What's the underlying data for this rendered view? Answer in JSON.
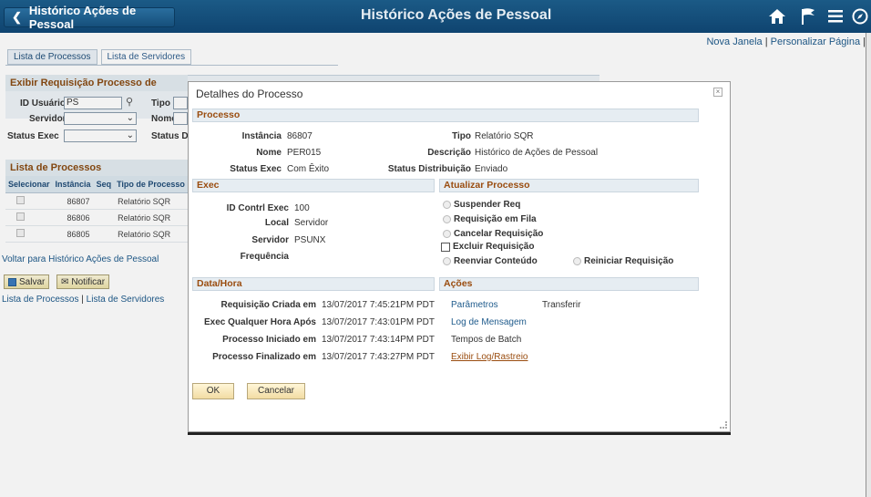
{
  "header": {
    "back_label": "Histórico Ações de Pessoal",
    "title": "Histórico Ações de Pessoal",
    "icons": [
      "home-icon",
      "flag-icon",
      "menu-icon",
      "navigator-icon"
    ]
  },
  "top_links": {
    "new_window": "Nova Janela",
    "separator": "|",
    "personalize": "Personalizar Página",
    "separator2": "|"
  },
  "bg": {
    "tabs": [
      "Lista de Processos",
      "Lista de Servidores"
    ],
    "search_header": "Exibir Requisição Processo de",
    "user_id_label": "ID Usuário",
    "user_id_value": "PS",
    "tipo_label": "Tipo",
    "servidor_label": "Servidor",
    "nome_label": "Nome",
    "status_exec_label": "Status Exec",
    "status_dist_label": "Status Di",
    "list_header": "Lista de Processos",
    "columns": [
      "Selecionar",
      "Instância",
      "Seq",
      "Tipo de Processo"
    ],
    "rows": [
      {
        "instance": "86807",
        "seq": "",
        "type": "Relatório SQR"
      },
      {
        "instance": "86806",
        "seq": "",
        "type": "Relatório SQR"
      },
      {
        "instance": "86805",
        "seq": "",
        "type": "Relatório SQR"
      }
    ],
    "return_link": "Voltar para Histórico Ações de Pessoal",
    "save_label": "Salvar",
    "notify_label": "Notificar",
    "footer_link1": "Lista de Processos",
    "footer_sep": "|",
    "footer_link2": "Lista de Servidores"
  },
  "modal": {
    "title": "Detalhes do Processo",
    "close": "×",
    "processo": {
      "header": "Processo",
      "instancia_label": "Instância",
      "instancia": "86807",
      "tipo_label": "Tipo",
      "tipo": "Relatório SQR",
      "nome_label": "Nome",
      "nome": "PER015",
      "descricao_label": "Descrição",
      "descricao": "Histórico de Ações de Pessoal",
      "status_exec_label": "Status Exec",
      "status_exec": "Com Êxito",
      "status_dist_label": "Status Distribuição",
      "status_dist": "Enviado"
    },
    "exec": {
      "header": "Exec",
      "id_contrl_label": "ID Contrl Exec",
      "id_contrl": "100",
      "local_label": "Local",
      "local": "Servidor",
      "servidor_label": "Servidor",
      "servidor": "PSUNX",
      "frequencia_label": "Frequência"
    },
    "atualizar": {
      "header": "Atualizar Processo",
      "options": [
        "Suspender Req",
        "Requisição em Fila",
        "Cancelar Requisição",
        "Excluir Requisição",
        "Reenviar Conteúdo",
        "Reiniciar Requisição"
      ]
    },
    "datahora": {
      "header": "Data/Hora",
      "rows": [
        {
          "label": "Requisição Criada em",
          "value": "13/07/2017  7:45:21PM PDT"
        },
        {
          "label": "Exec Qualquer Hora Após",
          "value": "13/07/2017  7:43:01PM PDT"
        },
        {
          "label": "Processo Iniciado em",
          "value": "13/07/2017  7:43:14PM PDT"
        },
        {
          "label": "Processo Finalizado em",
          "value": "13/07/2017  7:43:27PM PDT"
        }
      ]
    },
    "acoes": {
      "header": "Ações",
      "parametros": "Parâmetros",
      "transferir": "Transferir",
      "log_mensagem": "Log de Mensagem",
      "tempos_batch": "Tempos de Batch",
      "exibir_log": "Exibir Log/Rastreio"
    },
    "ok_label": "OK",
    "cancel_label": "Cancelar"
  },
  "colors": {
    "header_bg": "#154f7c",
    "section_text": "#9a4d10",
    "link": "#1f5b8c"
  }
}
